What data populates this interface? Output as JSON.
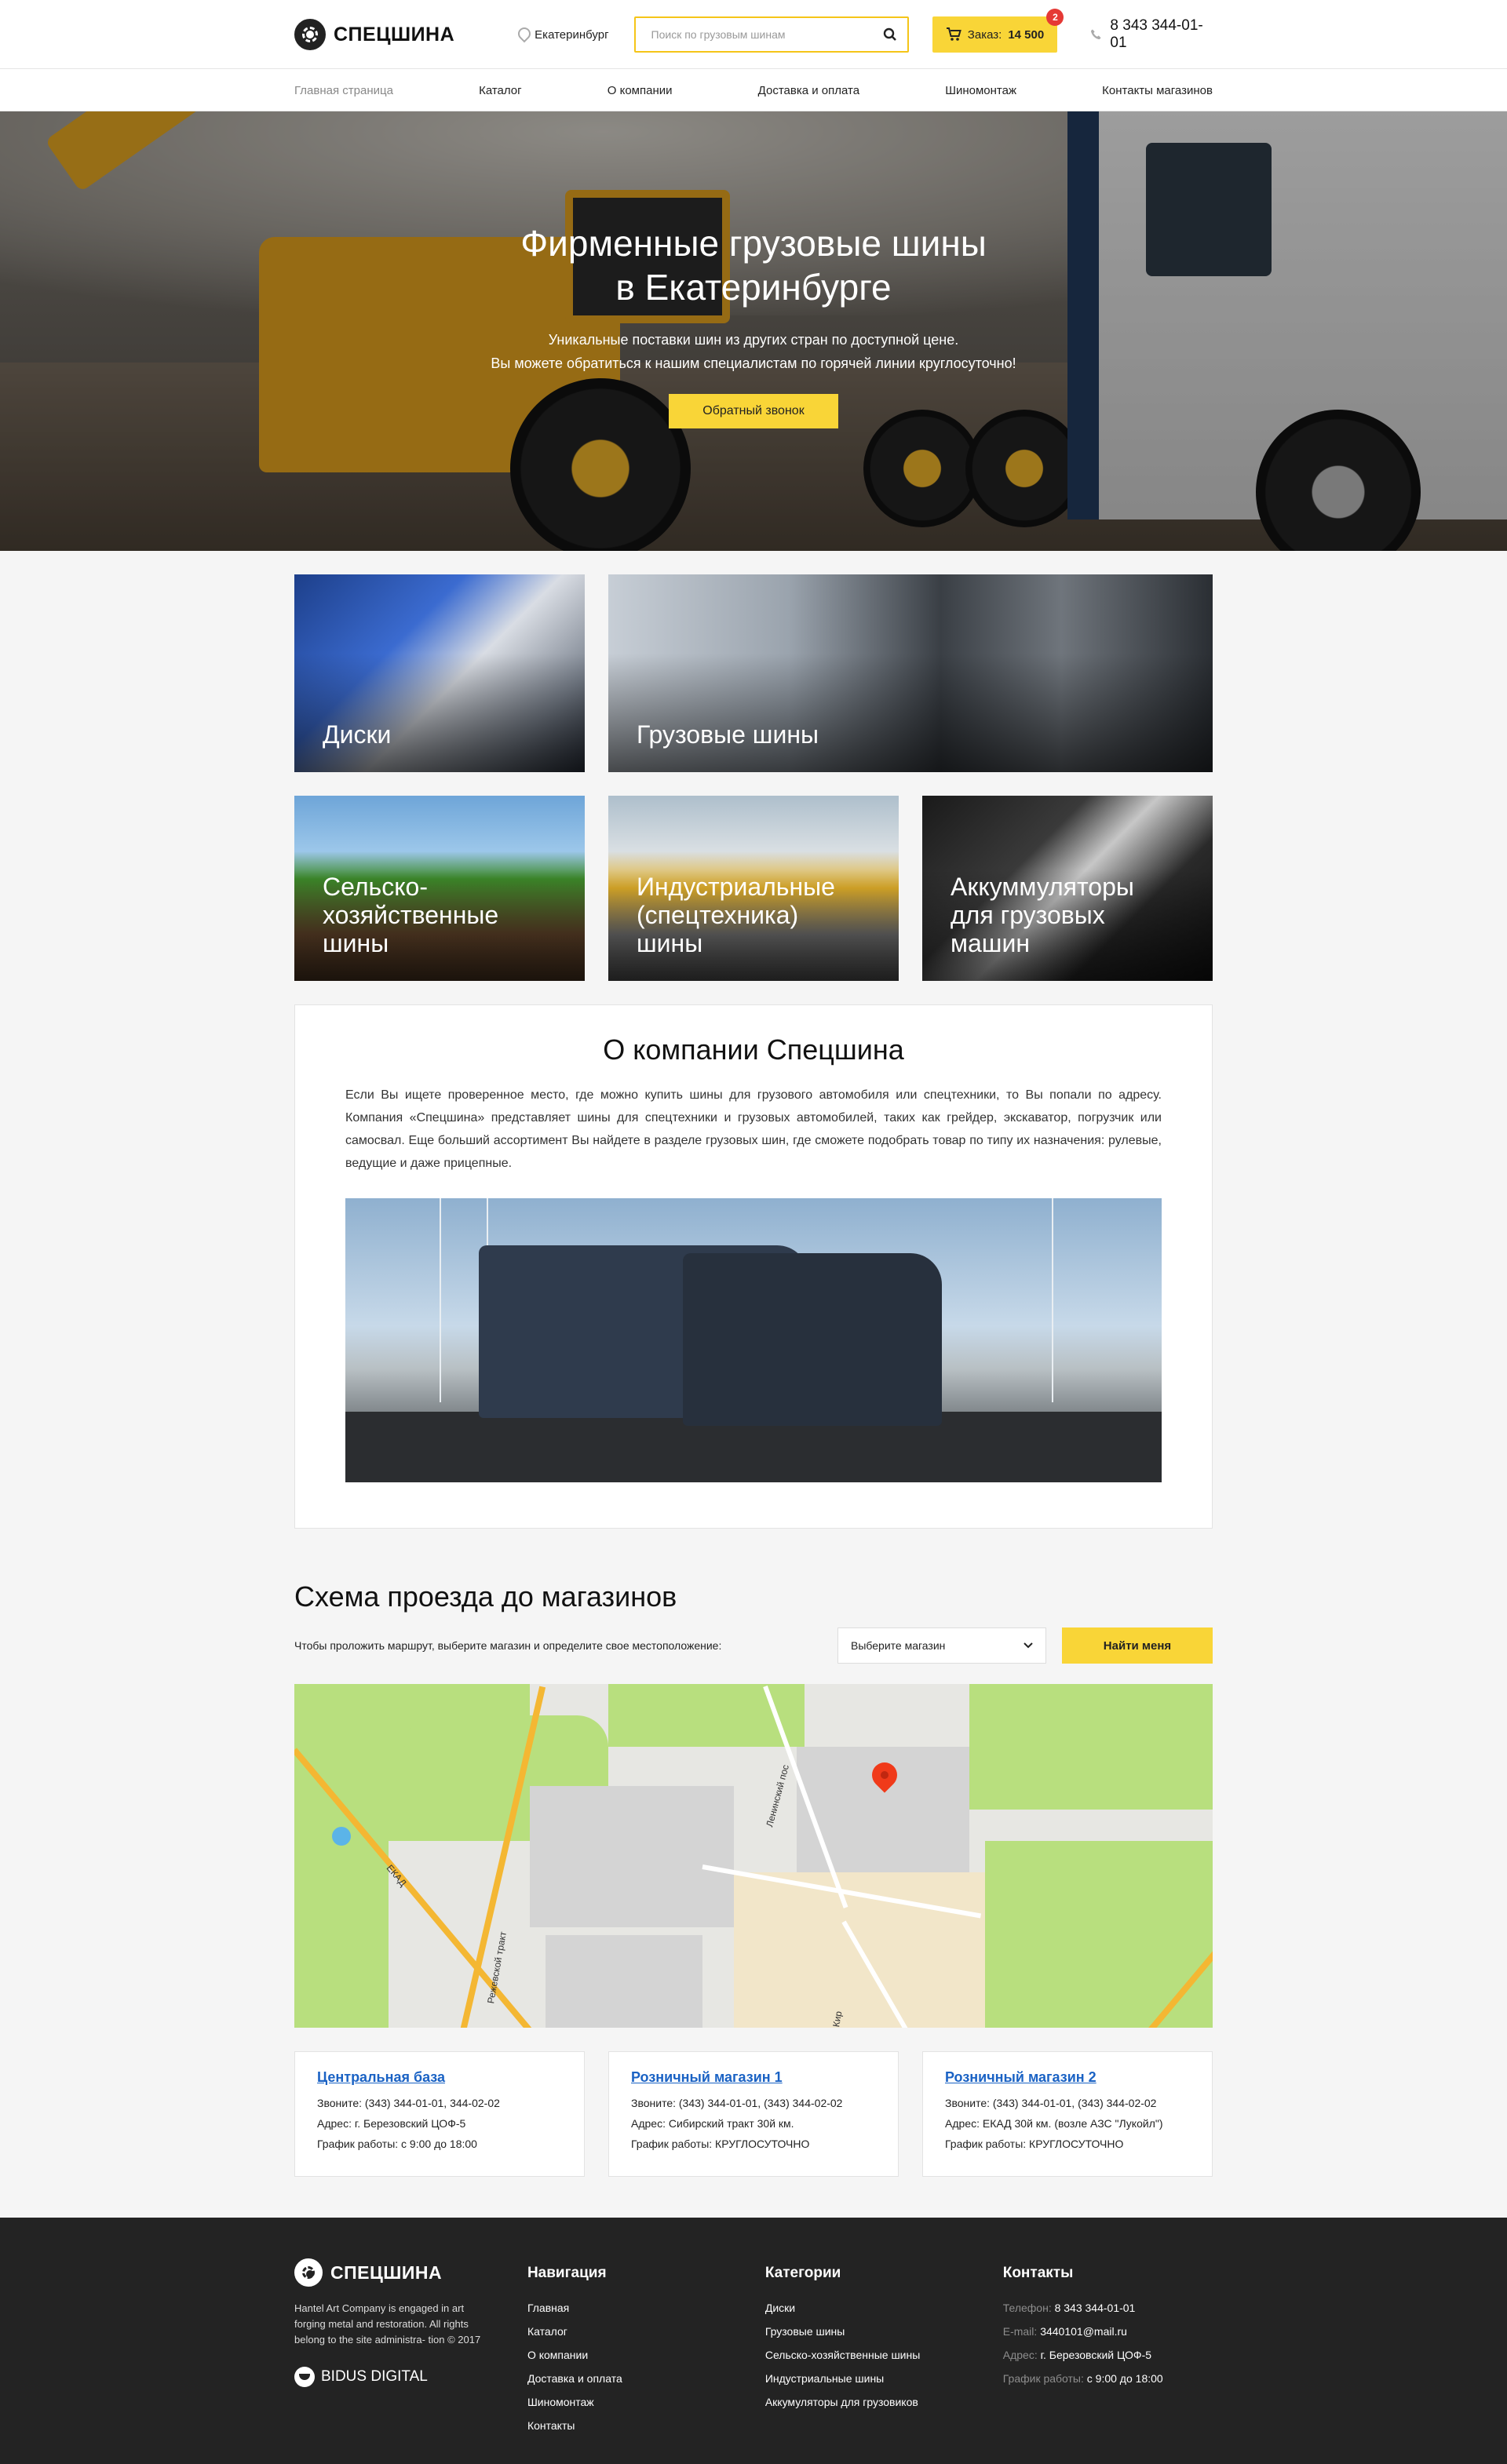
{
  "header": {
    "logo_text": "СПЕЦШИНА",
    "city": "Екатеринбург",
    "search_placeholder": "Поиск по грузовым шинам",
    "cart_label": "Заказ:",
    "cart_amount": "14 500",
    "cart_badge": "2",
    "phone": "8 343 344-01-01"
  },
  "nav": {
    "items": [
      {
        "label": "Главная страница"
      },
      {
        "label": "Каталог"
      },
      {
        "label": "О компании"
      },
      {
        "label": "Доставка и оплата"
      },
      {
        "label": "Шиномонтаж"
      },
      {
        "label": "Контакты магазинов"
      }
    ]
  },
  "hero": {
    "title": "Фирменные грузовые шины\nв Екатеринбурге",
    "subtitle": "Уникальные поставки шин из других стран по доступной цене.\nВы можете обратиться к нашим специалистам по горячей линии круглосуточно!",
    "button": "Обратный звонок"
  },
  "categories": [
    {
      "label": "Диски"
    },
    {
      "label": "Грузовые шины"
    },
    {
      "label": "Сельско-\nхозяйственные\nшины"
    },
    {
      "label": "Индустриальные\n(спецтехника)\nшины"
    },
    {
      "label": "Аккуммуляторы\nдля грузовых\nмашин"
    }
  ],
  "about": {
    "title": "О компании Спецшина",
    "text": "Если Вы ищете проверенное место, где можно купить шины для грузового автомобиля или спецтехники, то Вы попали по адресу. Компания «Спецшина» представляет шины для спецтехники и грузовых автомобилей, таких как грейдер, экскаватор, погрузчик или самосвал. Еще больший ассортимент Вы найдете в разделе грузовых шин, где сможете подобрать товар по типу их назначения: рулевые, ведущие и даже прицепные."
  },
  "map": {
    "title": "Схема проезда до магазинов",
    "hint": "Чтобы проложить маршрут, выберите магазин и определите свое местоположение:",
    "select_value": "Выберите магазин",
    "find_button": "Найти меня",
    "labels": {
      "ekad": "ЕКАД",
      "rezh": "Режевской тракт",
      "lenin": "Ленинский пос",
      "kir": "Кир"
    }
  },
  "stores": [
    {
      "name": "Центральная база",
      "phone": "Звоните: (343) 344-01-01, 344-02-02",
      "address": "Адрес: г. Березовский ЦОФ-5",
      "hours": "График работы: с 9:00 до 18:00"
    },
    {
      "name": "Розничный магазин 1",
      "phone": "Звоните: (343) 344-01-01, (343) 344-02-02",
      "address": "Адрес: Сибирский тракт 30й км.",
      "hours": "График работы: КРУГЛОСУТОЧНО"
    },
    {
      "name": "Розничный магазин 2",
      "phone": "Звоните: (343) 344-01-01, (343) 344-02-02",
      "address": "Адрес: ЕКАД 30й км. (возле АЗС \"Лукойл\")",
      "hours": "График работы: КРУГЛОСУТОЧНО"
    }
  ],
  "footer": {
    "logo_text": "СПЕЦШИНА",
    "about": "Hantel Art Company is engaged in art forging metal and restoration. All rights belong to the site administra- tion © 2017",
    "dev_logo": "BIDUS DIGITAL",
    "nav_title": "Навигация",
    "nav_items": [
      "Главная",
      "Каталог",
      "О компании",
      "Доставка и оплата",
      "Шиномонтаж",
      "Контакты"
    ],
    "cat_title": "Категории",
    "cat_items": [
      "Диски",
      "Грузовые шины",
      "Сельско-хозяйственные шины",
      "Индустриальные шины",
      "Аккумуляторы для грузовиков"
    ],
    "contacts_title": "Контакты",
    "phone_key": "Телефон:",
    "phone_val": "8 343 344-01-01",
    "email_key": "E-mail:",
    "email_val": "3440101@mail.ru",
    "addr_key": "Адрес:",
    "addr_val": "г. Березовский ЦОФ-5",
    "hours_key": "График работы:",
    "hours_val": "с 9:00 до 18:00"
  },
  "colors": {
    "accent": "#f9d537",
    "link": "#1a62c4",
    "footer_bg": "#232323",
    "badge": "#e53935"
  }
}
